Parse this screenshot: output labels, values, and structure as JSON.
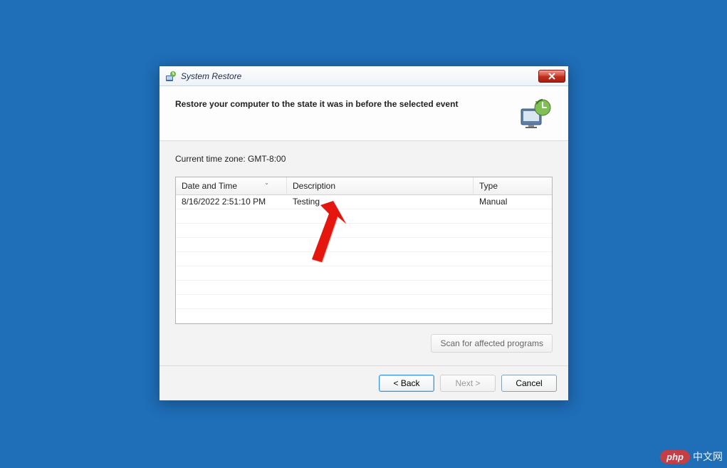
{
  "window": {
    "title": "System Restore"
  },
  "header": {
    "title": "Restore your computer to the state it was in before the selected event"
  },
  "content": {
    "timezone_label": "Current time zone: GMT-8:00"
  },
  "grid": {
    "columns": {
      "date": "Date and Time",
      "description": "Description",
      "type": "Type"
    },
    "rows": [
      {
        "date": "8/16/2022 2:51:10 PM",
        "description": "Testing",
        "type": "Manual"
      }
    ],
    "blank_rows": 8
  },
  "actions": {
    "scan": "Scan for affected programs",
    "back": "< Back",
    "next": "Next >",
    "cancel": "Cancel"
  },
  "watermark": {
    "logo": "php",
    "text": "中文网"
  }
}
